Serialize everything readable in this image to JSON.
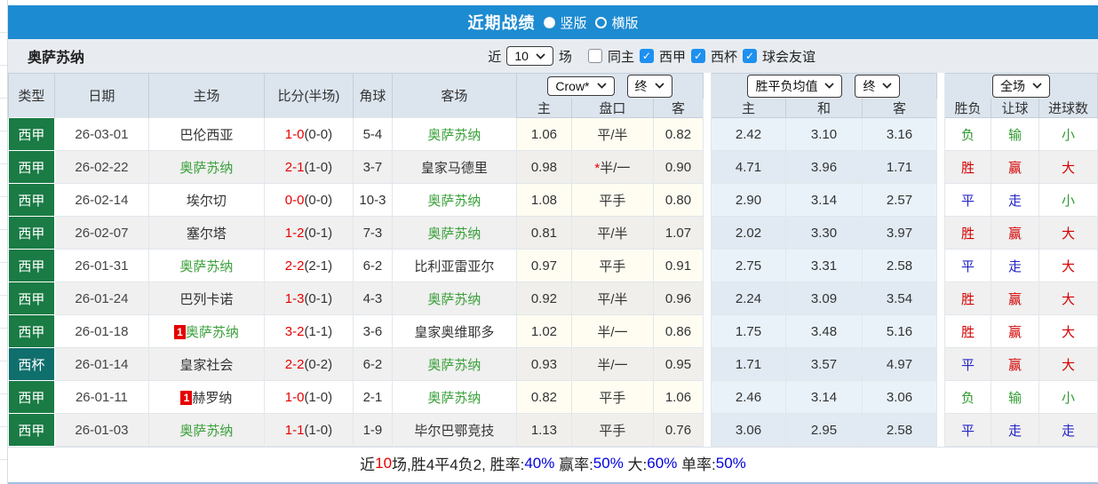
{
  "colors": {
    "bar": "#1d8bd1",
    "league_green": "#1a7b45",
    "league_teal": "#0f6f6d",
    "score_red": "#e60000",
    "verdict_red": "#d40000",
    "verdict_blue": "#2525c8",
    "verdict_green": "#2f9b2f",
    "team_green": "#3aa03a",
    "percent_blue": "#0000e0"
  },
  "titlebar": {
    "title": "近期战绩",
    "layout_options": [
      {
        "label": "竖版",
        "selected": true
      },
      {
        "label": "横版",
        "selected": false
      }
    ]
  },
  "filterbar": {
    "team": "奥萨苏纳",
    "recent_prefix": "近",
    "recent_count": "10",
    "recent_suffix": "场",
    "filters": [
      {
        "label": "同主",
        "checked": false
      },
      {
        "label": "西甲",
        "checked": true
      },
      {
        "label": "西杯",
        "checked": true
      },
      {
        "label": "球会友谊",
        "checked": true
      }
    ]
  },
  "table": {
    "selects": {
      "odds_source": "Crow*",
      "odds_time": "终",
      "avg_source": "胜平负均值",
      "avg_time": "终",
      "scope": "全场"
    },
    "headers": {
      "type": "类型",
      "date": "日期",
      "home": "主场",
      "score": "比分(半场)",
      "corner": "角球",
      "away": "客场",
      "odds_home": "主",
      "handicap": "盘口",
      "odds_away": "客",
      "avg_home": "主",
      "avg_draw": "和",
      "avg_away": "客",
      "result": "胜负",
      "handicap_result": "让球",
      "goals": "进球数"
    },
    "rows": [
      {
        "type": "西甲",
        "type_color": "green",
        "date": "26-03-01",
        "home": {
          "name": "巴伦西亚",
          "green": false,
          "card": ""
        },
        "score": "1-0",
        "half": "(0-0)",
        "corner": "5-4",
        "away": {
          "name": "奥萨苏纳",
          "green": true,
          "card": ""
        },
        "odds": {
          "home": "1.06",
          "handicap": "平/半",
          "star": false,
          "away": "0.82"
        },
        "avg": {
          "home": "2.42",
          "draw": "3.10",
          "away": "3.16"
        },
        "verdicts": {
          "result": {
            "text": "负",
            "color": "green"
          },
          "handicap": {
            "text": "输",
            "color": "green"
          },
          "goals": {
            "text": "小",
            "color": "green"
          }
        }
      },
      {
        "type": "西甲",
        "type_color": "green",
        "date": "26-02-22",
        "home": {
          "name": "奥萨苏纳",
          "green": true,
          "card": ""
        },
        "score": "2-1",
        "half": "(1-0)",
        "corner": "3-7",
        "away": {
          "name": "皇家马德里",
          "green": false,
          "card": ""
        },
        "odds": {
          "home": "0.98",
          "handicap": "半/一",
          "star": true,
          "away": "0.90"
        },
        "avg": {
          "home": "4.71",
          "draw": "3.96",
          "away": "1.71"
        },
        "verdicts": {
          "result": {
            "text": "胜",
            "color": "red"
          },
          "handicap": {
            "text": "赢",
            "color": "red"
          },
          "goals": {
            "text": "大",
            "color": "red"
          }
        }
      },
      {
        "type": "西甲",
        "type_color": "green",
        "date": "26-02-14",
        "home": {
          "name": "埃尔切",
          "green": false,
          "card": ""
        },
        "score": "0-0",
        "half": "(0-0)",
        "corner": "10-3",
        "away": {
          "name": "奥萨苏纳",
          "green": true,
          "card": ""
        },
        "odds": {
          "home": "1.08",
          "handicap": "平手",
          "star": false,
          "away": "0.80"
        },
        "avg": {
          "home": "2.90",
          "draw": "3.14",
          "away": "2.57"
        },
        "verdicts": {
          "result": {
            "text": "平",
            "color": "blue"
          },
          "handicap": {
            "text": "走",
            "color": "blue"
          },
          "goals": {
            "text": "小",
            "color": "green"
          }
        }
      },
      {
        "type": "西甲",
        "type_color": "green",
        "date": "26-02-07",
        "home": {
          "name": "塞尔塔",
          "green": false,
          "card": ""
        },
        "score": "1-2",
        "half": "(0-1)",
        "corner": "7-3",
        "away": {
          "name": "奥萨苏纳",
          "green": true,
          "card": ""
        },
        "odds": {
          "home": "0.81",
          "handicap": "平/半",
          "star": false,
          "away": "1.07"
        },
        "avg": {
          "home": "2.02",
          "draw": "3.30",
          "away": "3.97"
        },
        "verdicts": {
          "result": {
            "text": "胜",
            "color": "red"
          },
          "handicap": {
            "text": "赢",
            "color": "red"
          },
          "goals": {
            "text": "大",
            "color": "red"
          }
        }
      },
      {
        "type": "西甲",
        "type_color": "green",
        "date": "26-01-31",
        "home": {
          "name": "奥萨苏纳",
          "green": true,
          "card": ""
        },
        "score": "2-2",
        "half": "(2-1)",
        "corner": "6-2",
        "away": {
          "name": "比利亚雷亚尔",
          "green": false,
          "card": ""
        },
        "odds": {
          "home": "0.97",
          "handicap": "平手",
          "star": false,
          "away": "0.91"
        },
        "avg": {
          "home": "2.75",
          "draw": "3.31",
          "away": "2.58"
        },
        "verdicts": {
          "result": {
            "text": "平",
            "color": "blue"
          },
          "handicap": {
            "text": "走",
            "color": "blue"
          },
          "goals": {
            "text": "大",
            "color": "red"
          }
        }
      },
      {
        "type": "西甲",
        "type_color": "green",
        "date": "26-01-24",
        "home": {
          "name": "巴列卡诺",
          "green": false,
          "card": ""
        },
        "score": "1-3",
        "half": "(0-1)",
        "corner": "4-3",
        "away": {
          "name": "奥萨苏纳",
          "green": true,
          "card": ""
        },
        "odds": {
          "home": "0.92",
          "handicap": "平/半",
          "star": false,
          "away": "0.96"
        },
        "avg": {
          "home": "2.24",
          "draw": "3.09",
          "away": "3.54"
        },
        "verdicts": {
          "result": {
            "text": "胜",
            "color": "red"
          },
          "handicap": {
            "text": "赢",
            "color": "red"
          },
          "goals": {
            "text": "大",
            "color": "red"
          }
        }
      },
      {
        "type": "西甲",
        "type_color": "green",
        "date": "26-01-18",
        "home": {
          "name": "奥萨苏纳",
          "green": true,
          "card": "1"
        },
        "score": "3-2",
        "half": "(1-1)",
        "corner": "3-6",
        "away": {
          "name": "皇家奥维耶多",
          "green": false,
          "card": ""
        },
        "odds": {
          "home": "1.02",
          "handicap": "半/一",
          "star": false,
          "away": "0.86"
        },
        "avg": {
          "home": "1.75",
          "draw": "3.48",
          "away": "5.16"
        },
        "verdicts": {
          "result": {
            "text": "胜",
            "color": "red"
          },
          "handicap": {
            "text": "赢",
            "color": "red"
          },
          "goals": {
            "text": "大",
            "color": "red"
          }
        }
      },
      {
        "type": "西杯",
        "type_color": "teal",
        "date": "26-01-14",
        "home": {
          "name": "皇家社会",
          "green": false,
          "card": ""
        },
        "score": "2-2",
        "half": "(0-2)",
        "corner": "6-2",
        "away": {
          "name": "奥萨苏纳",
          "green": true,
          "card": ""
        },
        "odds": {
          "home": "0.93",
          "handicap": "半/一",
          "star": false,
          "away": "0.95"
        },
        "avg": {
          "home": "1.71",
          "draw": "3.57",
          "away": "4.97"
        },
        "verdicts": {
          "result": {
            "text": "平",
            "color": "blue"
          },
          "handicap": {
            "text": "赢",
            "color": "red"
          },
          "goals": {
            "text": "大",
            "color": "red"
          }
        }
      },
      {
        "type": "西甲",
        "type_color": "green",
        "date": "26-01-11",
        "home": {
          "name": "赫罗纳",
          "green": false,
          "card": "1"
        },
        "score": "1-0",
        "half": "(1-0)",
        "corner": "2-1",
        "away": {
          "name": "奥萨苏纳",
          "green": true,
          "card": ""
        },
        "odds": {
          "home": "0.82",
          "handicap": "平手",
          "star": false,
          "away": "1.06"
        },
        "avg": {
          "home": "2.46",
          "draw": "3.14",
          "away": "3.06"
        },
        "verdicts": {
          "result": {
            "text": "负",
            "color": "green"
          },
          "handicap": {
            "text": "输",
            "color": "green"
          },
          "goals": {
            "text": "小",
            "color": "green"
          }
        }
      },
      {
        "type": "西甲",
        "type_color": "green",
        "date": "26-01-03",
        "home": {
          "name": "奥萨苏纳",
          "green": true,
          "card": ""
        },
        "score": "1-1",
        "half": "(1-0)",
        "corner": "1-9",
        "away": {
          "name": "毕尔巴鄂竞技",
          "green": false,
          "card": ""
        },
        "odds": {
          "home": "1.13",
          "handicap": "平手",
          "star": false,
          "away": "0.76"
        },
        "avg": {
          "home": "3.06",
          "draw": "2.95",
          "away": "2.58"
        },
        "verdicts": {
          "result": {
            "text": "平",
            "color": "blue"
          },
          "handicap": {
            "text": "走",
            "color": "blue"
          },
          "goals": {
            "text": "走",
            "color": "blue"
          }
        }
      }
    ]
  },
  "summary": {
    "segments": [
      {
        "text": "近",
        "color": "dark"
      },
      {
        "text": "10",
        "color": "red"
      },
      {
        "text": "场,胜4平4负2, 胜率:",
        "color": "dark"
      },
      {
        "text": "40%",
        "color": "blue"
      },
      {
        "text": " 赢率:",
        "color": "dark"
      },
      {
        "text": "50%",
        "color": "blue"
      },
      {
        "text": " 大:",
        "color": "dark"
      },
      {
        "text": "60%",
        "color": "blue"
      },
      {
        "text": " 单率:",
        "color": "dark"
      },
      {
        "text": "50%",
        "color": "blue"
      }
    ]
  }
}
